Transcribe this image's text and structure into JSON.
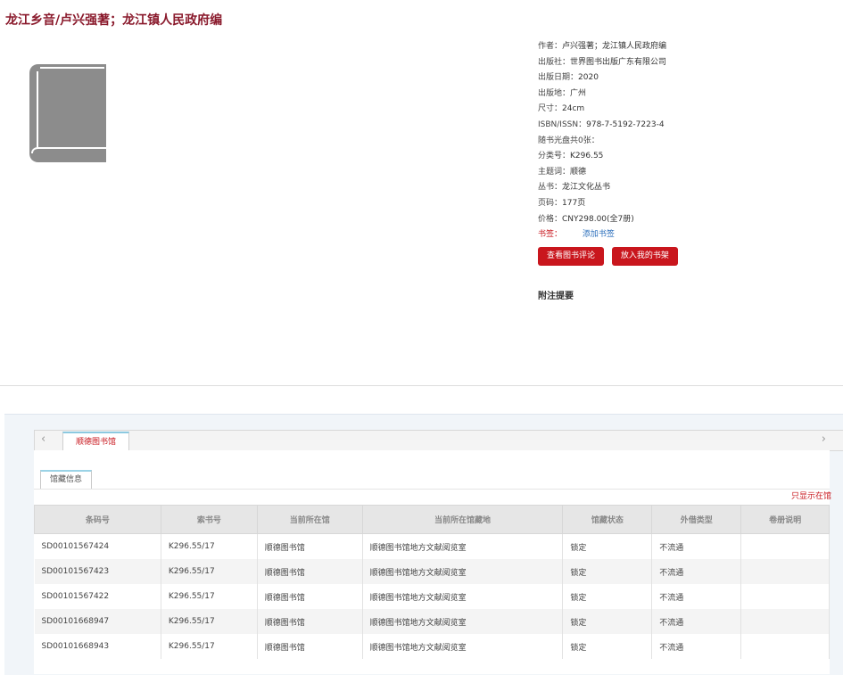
{
  "book": {
    "title": "龙江乡音/卢兴强著；龙江镇人民政府编",
    "meta": [
      {
        "label": "作者：",
        "value": "卢兴强著；龙江镇人民政府编"
      },
      {
        "label": "出版社：",
        "value": "世界图书出版广东有限公司"
      },
      {
        "label": "出版日期：",
        "value": "2020"
      },
      {
        "label": "出版地：",
        "value": "广州"
      },
      {
        "label": "尺寸：",
        "value": "24cm"
      },
      {
        "label": "ISBN/ISSN：",
        "value": "978-7-5192-7223-4"
      },
      {
        "label": "随书光盘共0张：",
        "value": ""
      },
      {
        "label": "分类号：",
        "value": "K296.55"
      },
      {
        "label": "主题词：",
        "value": "顺德"
      },
      {
        "label": "丛书：",
        "value": "龙江文化丛书"
      },
      {
        "label": "页码：",
        "value": "177页"
      },
      {
        "label": "价格：",
        "value": "CNY298.00(全7册)"
      }
    ],
    "bookmark_label": "书签：",
    "bookmark_link": "添加书签"
  },
  "actions": {
    "review_button": "查看图书评论",
    "shelf_button": "放入我的书架"
  },
  "note_heading": "附注提要",
  "library_tab": "顺德图书馆",
  "holdings_tab": "馆藏信息",
  "show_all": "只显示在馆",
  "colors": {
    "accent": "#c9161d",
    "title": "#8a1a2c",
    "link": "#2a6ebb"
  },
  "icons": {
    "cover": "book-icon",
    "prev": "chevron-left-icon",
    "next": "chevron-right-icon"
  },
  "table": {
    "headers": [
      "条码号",
      "索书号",
      "当前所在馆",
      "当前所在馆藏地",
      "馆藏状态",
      "外借类型",
      "卷册说明"
    ],
    "rows": [
      [
        "SD00101567424",
        "K296.55/17",
        "顺德图书馆",
        "顺德图书馆地方文献阅览室",
        "锁定",
        "不流通",
        ""
      ],
      [
        "SD00101567423",
        "K296.55/17",
        "顺德图书馆",
        "顺德图书馆地方文献阅览室",
        "锁定",
        "不流通",
        ""
      ],
      [
        "SD00101567422",
        "K296.55/17",
        "顺德图书馆",
        "顺德图书馆地方文献阅览室",
        "锁定",
        "不流通",
        ""
      ],
      [
        "SD00101668947",
        "K296.55/17",
        "顺德图书馆",
        "顺德图书馆地方文献阅览室",
        "锁定",
        "不流通",
        ""
      ],
      [
        "SD00101668943",
        "K296.55/17",
        "顺德图书馆",
        "顺德图书馆地方文献阅览室",
        "锁定",
        "不流通",
        ""
      ]
    ]
  }
}
